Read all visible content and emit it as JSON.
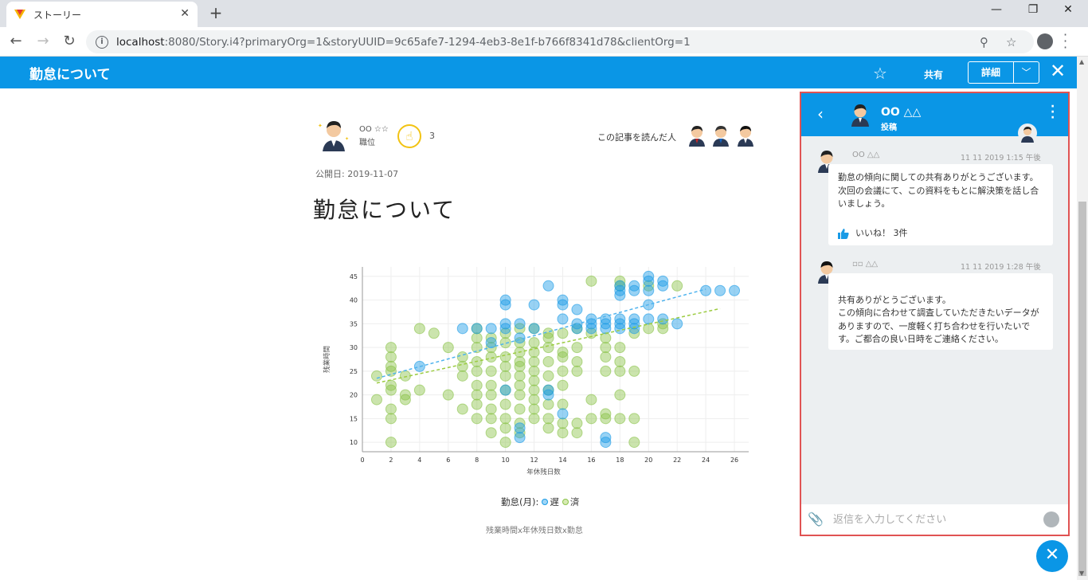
{
  "browser": {
    "tab_title": "ストーリー",
    "url_host": "localhost",
    "url_path": ":8080/Story.i4?primaryOrg=1&storyUUID=9c65afe7-1294-4eb3-8e1f-b766f8341d78&clientOrg=1"
  },
  "appbar": {
    "title": "勤怠について",
    "share_label": "共有",
    "detail_label": "詳細"
  },
  "article": {
    "author_name": "OO ☆☆",
    "author_position": "職位",
    "clap_count": "3",
    "readers_label": "この記事を読んだ人",
    "published": "公開日: 2019-11-07",
    "title": "勤怠について",
    "legend_title": "勤怠(月):",
    "legend_late": "遅",
    "legend_done": "済",
    "caption": "残業時間x年休残日数x勤怠"
  },
  "chart_data": {
    "type": "scatter",
    "xlabel": "年休残日数",
    "ylabel": "残業時間",
    "xlim": [
      0,
      27
    ],
    "ylim": [
      8,
      47
    ],
    "xticks": [
      0,
      2,
      4,
      6,
      8,
      10,
      12,
      14,
      16,
      18,
      20,
      22,
      24,
      26
    ],
    "yticks": [
      10,
      15,
      20,
      25,
      30,
      35,
      40,
      45
    ],
    "colors": {
      "late": "#1a9be6",
      "done": "#8bc34a",
      "late_trend": "#4fb3ee",
      "done_trend": "#9ccc41"
    },
    "series": [
      {
        "name": "遅",
        "points": [
          [
            4,
            26
          ],
          [
            7,
            34
          ],
          [
            8,
            34
          ],
          [
            9,
            31
          ],
          [
            9,
            34
          ],
          [
            10,
            21
          ],
          [
            10,
            34
          ],
          [
            10,
            35
          ],
          [
            10,
            39
          ],
          [
            10,
            40
          ],
          [
            11,
            11
          ],
          [
            11,
            13
          ],
          [
            11,
            32
          ],
          [
            11,
            35
          ],
          [
            12,
            34
          ],
          [
            12,
            39
          ],
          [
            13,
            20
          ],
          [
            13,
            21
          ],
          [
            13,
            43
          ],
          [
            14,
            16
          ],
          [
            14,
            36
          ],
          [
            14,
            39
          ],
          [
            14,
            40
          ],
          [
            15,
            34
          ],
          [
            15,
            35
          ],
          [
            15,
            38
          ],
          [
            16,
            34
          ],
          [
            16,
            35
          ],
          [
            16,
            36
          ],
          [
            17,
            10
          ],
          [
            17,
            11
          ],
          [
            17,
            34
          ],
          [
            17,
            35
          ],
          [
            17,
            36
          ],
          [
            18,
            34
          ],
          [
            18,
            35
          ],
          [
            18,
            36
          ],
          [
            18,
            41
          ],
          [
            18,
            42
          ],
          [
            18,
            43
          ],
          [
            19,
            34
          ],
          [
            19,
            35
          ],
          [
            19,
            36
          ],
          [
            19,
            42
          ],
          [
            19,
            43
          ],
          [
            20,
            36
          ],
          [
            20,
            39
          ],
          [
            20,
            42
          ],
          [
            20,
            44
          ],
          [
            20,
            45
          ],
          [
            21,
            36
          ],
          [
            21,
            43
          ],
          [
            21,
            44
          ],
          [
            22,
            35
          ],
          [
            24,
            42
          ],
          [
            25,
            42
          ],
          [
            26,
            42
          ]
        ],
        "trend": [
          [
            1,
            23.5
          ],
          [
            24,
            42.3
          ]
        ]
      },
      {
        "name": "済",
        "points": [
          [
            1,
            19
          ],
          [
            1,
            24
          ],
          [
            2,
            10
          ],
          [
            2,
            15
          ],
          [
            2,
            17
          ],
          [
            2,
            21
          ],
          [
            2,
            22
          ],
          [
            2,
            25
          ],
          [
            2,
            26
          ],
          [
            2,
            28
          ],
          [
            2,
            30
          ],
          [
            3,
            19
          ],
          [
            3,
            20
          ],
          [
            3,
            24
          ],
          [
            4,
            21
          ],
          [
            4,
            34
          ],
          [
            5,
            33
          ],
          [
            6,
            20
          ],
          [
            6,
            30
          ],
          [
            7,
            17
          ],
          [
            7,
            24
          ],
          [
            7,
            26
          ],
          [
            7,
            28
          ],
          [
            8,
            15
          ],
          [
            8,
            18
          ],
          [
            8,
            20
          ],
          [
            8,
            22
          ],
          [
            8,
            25
          ],
          [
            8,
            27
          ],
          [
            8,
            30
          ],
          [
            8,
            32
          ],
          [
            8,
            34
          ],
          [
            9,
            12
          ],
          [
            9,
            15
          ],
          [
            9,
            17
          ],
          [
            9,
            20
          ],
          [
            9,
            22
          ],
          [
            9,
            25
          ],
          [
            9,
            28
          ],
          [
            9,
            30
          ],
          [
            9,
            32
          ],
          [
            10,
            10
          ],
          [
            10,
            13
          ],
          [
            10,
            15
          ],
          [
            10,
            18
          ],
          [
            10,
            21
          ],
          [
            10,
            24
          ],
          [
            10,
            26
          ],
          [
            10,
            28
          ],
          [
            10,
            31
          ],
          [
            10,
            33
          ],
          [
            11,
            12
          ],
          [
            11,
            14
          ],
          [
            11,
            17
          ],
          [
            11,
            20
          ],
          [
            11,
            22
          ],
          [
            11,
            24
          ],
          [
            11,
            26
          ],
          [
            11,
            27
          ],
          [
            11,
            29
          ],
          [
            11,
            31
          ],
          [
            11,
            34
          ],
          [
            12,
            15
          ],
          [
            12,
            17
          ],
          [
            12,
            19
          ],
          [
            12,
            21
          ],
          [
            12,
            23
          ],
          [
            12,
            25
          ],
          [
            12,
            27
          ],
          [
            12,
            29
          ],
          [
            12,
            31
          ],
          [
            12,
            34
          ],
          [
            13,
            13
          ],
          [
            13,
            15
          ],
          [
            13,
            18
          ],
          [
            13,
            21
          ],
          [
            13,
            24
          ],
          [
            13,
            27
          ],
          [
            13,
            30
          ],
          [
            13,
            32
          ],
          [
            13,
            33
          ],
          [
            14,
            12
          ],
          [
            14,
            14
          ],
          [
            14,
            18
          ],
          [
            14,
            22
          ],
          [
            14,
            25
          ],
          [
            14,
            28
          ],
          [
            14,
            29
          ],
          [
            14,
            33
          ],
          [
            15,
            12
          ],
          [
            15,
            14
          ],
          [
            15,
            25
          ],
          [
            15,
            27
          ],
          [
            15,
            30
          ],
          [
            15,
            34
          ],
          [
            16,
            15
          ],
          [
            16,
            19
          ],
          [
            16,
            33
          ],
          [
            16,
            44
          ],
          [
            17,
            15
          ],
          [
            17,
            16
          ],
          [
            17,
            25
          ],
          [
            17,
            28
          ],
          [
            17,
            30
          ],
          [
            17,
            32
          ],
          [
            18,
            15
          ],
          [
            18,
            20
          ],
          [
            18,
            25
          ],
          [
            18,
            27
          ],
          [
            18,
            30
          ],
          [
            18,
            43
          ],
          [
            18,
            44
          ],
          [
            19,
            10
          ],
          [
            19,
            15
          ],
          [
            19,
            25
          ],
          [
            19,
            33
          ],
          [
            20,
            34
          ],
          [
            20,
            43
          ],
          [
            21,
            34
          ],
          [
            21,
            35
          ],
          [
            22,
            43
          ]
        ],
        "trend": [
          [
            1,
            22.5
          ],
          [
            25,
            38.2
          ]
        ]
      }
    ]
  },
  "panel": {
    "user_name": "OO △△",
    "subtitle": "投稿",
    "comments": [
      {
        "author": "OO △△",
        "time": "11 11 2019 1:15 午後",
        "text": "勤怠の傾向に関しての共有ありがとうございます。次回の会議にて、この資料をもとに解決策を話し合いましょう。",
        "like_label": "いいね！ 3件"
      },
      {
        "author": "▫▫ △△",
        "time": "11 11 2019 1:28 午後",
        "text": "共有ありがとうございます。\nこの傾向に合わせて調査していただきたいデータがありますので、一度軽く打ち合わせを行いたいです。ご都合の良い日時をご連絡ください。"
      }
    ],
    "reply_placeholder": "返信を入力してください"
  }
}
